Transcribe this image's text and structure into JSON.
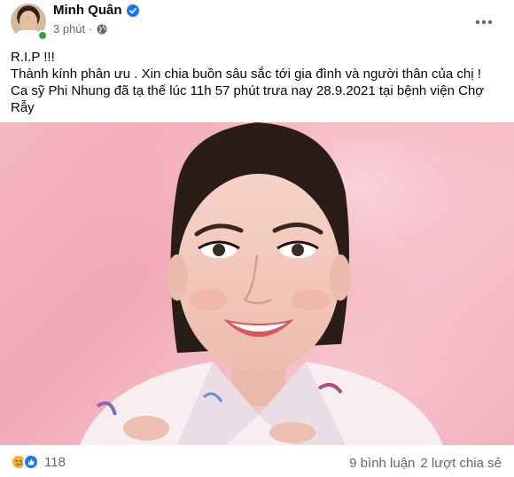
{
  "post": {
    "author": "Minh Quân",
    "timestamp": "3 phút",
    "privacy_icon": "globe-icon",
    "verified_icon": "verified-badge-icon",
    "lines": [
      "R.I.P !!!",
      "Thành kính phân ưu . Xin chia buồn sâu sắc tới gia đình và người thân của chị !",
      "Ca sỹ Phi Nhung đã tạ thế lúc 11h 57 phút trưa nay 28.9.2021 tại bệnh viện Chợ Rẫy"
    ]
  },
  "reactions": {
    "icons": [
      "sad-reaction-icon",
      "like-reaction-icon"
    ],
    "count": "118"
  },
  "stats": {
    "comments": "9 bình luận",
    "shares": "2 lượt chia sẻ"
  },
  "colors": {
    "verified": "#1877f2",
    "online": "#31a24c",
    "secondary_text": "#65676b",
    "photo_background": "#f4b7c1"
  }
}
